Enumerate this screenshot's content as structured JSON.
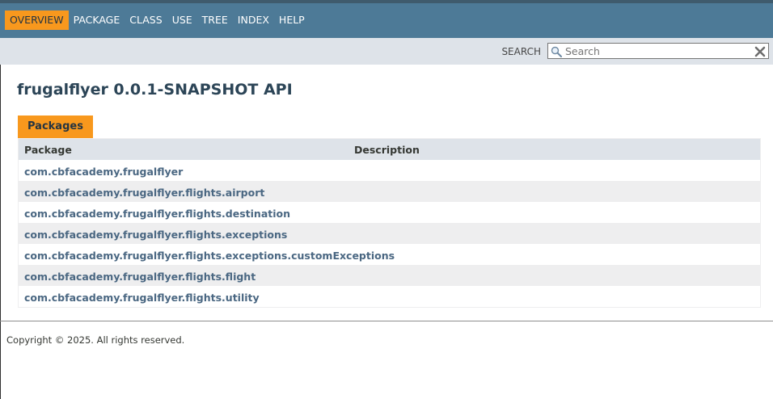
{
  "nav": {
    "items": [
      {
        "label": "OVERVIEW",
        "active": true
      },
      {
        "label": "PACKAGE",
        "active": false
      },
      {
        "label": "CLASS",
        "active": false
      },
      {
        "label": "USE",
        "active": false
      },
      {
        "label": "TREE",
        "active": false
      },
      {
        "label": "INDEX",
        "active": false
      },
      {
        "label": "HELP",
        "active": false
      }
    ]
  },
  "search": {
    "label": "SEARCH",
    "placeholder": "Search",
    "value": ""
  },
  "page": {
    "title": "frugalflyer 0.0.1-SNAPSHOT API"
  },
  "packages": {
    "caption": "Packages",
    "columns": {
      "package": "Package",
      "description": "Description"
    },
    "rows": [
      {
        "name": "com.cbfacademy.frugalflyer",
        "description": ""
      },
      {
        "name": "com.cbfacademy.frugalflyer.flights.airport",
        "description": ""
      },
      {
        "name": "com.cbfacademy.frugalflyer.flights.destination",
        "description": ""
      },
      {
        "name": "com.cbfacademy.frugalflyer.flights.exceptions",
        "description": ""
      },
      {
        "name": "com.cbfacademy.frugalflyer.flights.exceptions.customExceptions",
        "description": ""
      },
      {
        "name": "com.cbfacademy.frugalflyer.flights.flight",
        "description": ""
      },
      {
        "name": "com.cbfacademy.frugalflyer.flights.utility",
        "description": ""
      }
    ]
  },
  "footer": {
    "copyright": "Copyright © 2025. All rights reserved."
  },
  "icons": {
    "search": "search-icon",
    "reset": "close-icon"
  },
  "colors": {
    "nav_bg": "#4d7a97",
    "nav_active": "#f8981d",
    "subnav_bg": "#dee3e9",
    "link": "#4a6782",
    "row_alt": "#eeeeef"
  }
}
